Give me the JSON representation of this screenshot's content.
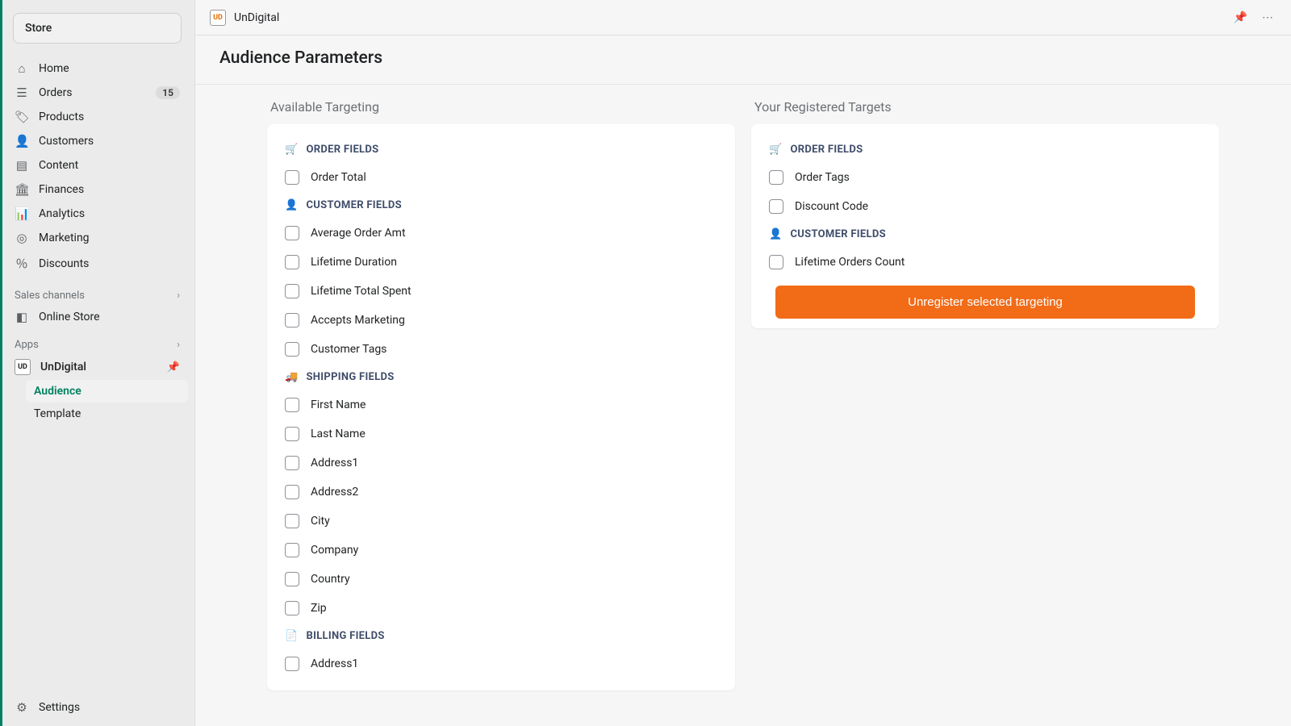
{
  "sidebar": {
    "store_label": "Store",
    "nav": [
      {
        "icon": "⌂",
        "label": "Home"
      },
      {
        "icon": "☰",
        "label": "Orders",
        "badge": "15"
      },
      {
        "icon": "🏷",
        "label": "Products"
      },
      {
        "icon": "👤",
        "label": "Customers"
      },
      {
        "icon": "▤",
        "label": "Content"
      },
      {
        "icon": "🏛",
        "label": "Finances"
      },
      {
        "icon": "📊",
        "label": "Analytics"
      },
      {
        "icon": "◎",
        "label": "Marketing"
      },
      {
        "icon": "％",
        "label": "Discounts"
      }
    ],
    "sales_channels_label": "Sales channels",
    "online_store_label": "Online Store",
    "apps_label": "Apps",
    "app_name": "UnDigital",
    "subnav": [
      {
        "label": "Audience",
        "active": true
      },
      {
        "label": "Template",
        "active": false
      }
    ],
    "settings_label": "Settings"
  },
  "topbar": {
    "app_name": "UnDigital"
  },
  "page": {
    "title": "Audience Parameters"
  },
  "available": {
    "title": "Available Targeting",
    "groups": [
      {
        "icon": "🛒",
        "label": "ORDER FIELDS",
        "items": [
          "Order Total"
        ]
      },
      {
        "icon": "👤",
        "label": "CUSTOMER FIELDS",
        "items": [
          "Average Order Amt",
          "Lifetime Duration",
          "Lifetime Total Spent",
          "Accepts Marketing",
          "Customer Tags"
        ]
      },
      {
        "icon": "🚚",
        "label": "SHIPPING FIELDS",
        "items": [
          "First Name",
          "Last Name",
          "Address1",
          "Address2",
          "City",
          "Company",
          "Country",
          "Zip"
        ]
      },
      {
        "icon": "📄",
        "label": "BILLING FIELDS",
        "items": [
          "Address1"
        ]
      }
    ]
  },
  "registered": {
    "title": "Your Registered Targets",
    "groups": [
      {
        "icon": "🛒",
        "label": "ORDER FIELDS",
        "items": [
          "Order Tags",
          "Discount Code"
        ]
      },
      {
        "icon": "👤",
        "label": "CUSTOMER FIELDS",
        "items": [
          "Lifetime Orders Count"
        ]
      }
    ],
    "button": "Unregister selected targeting"
  }
}
